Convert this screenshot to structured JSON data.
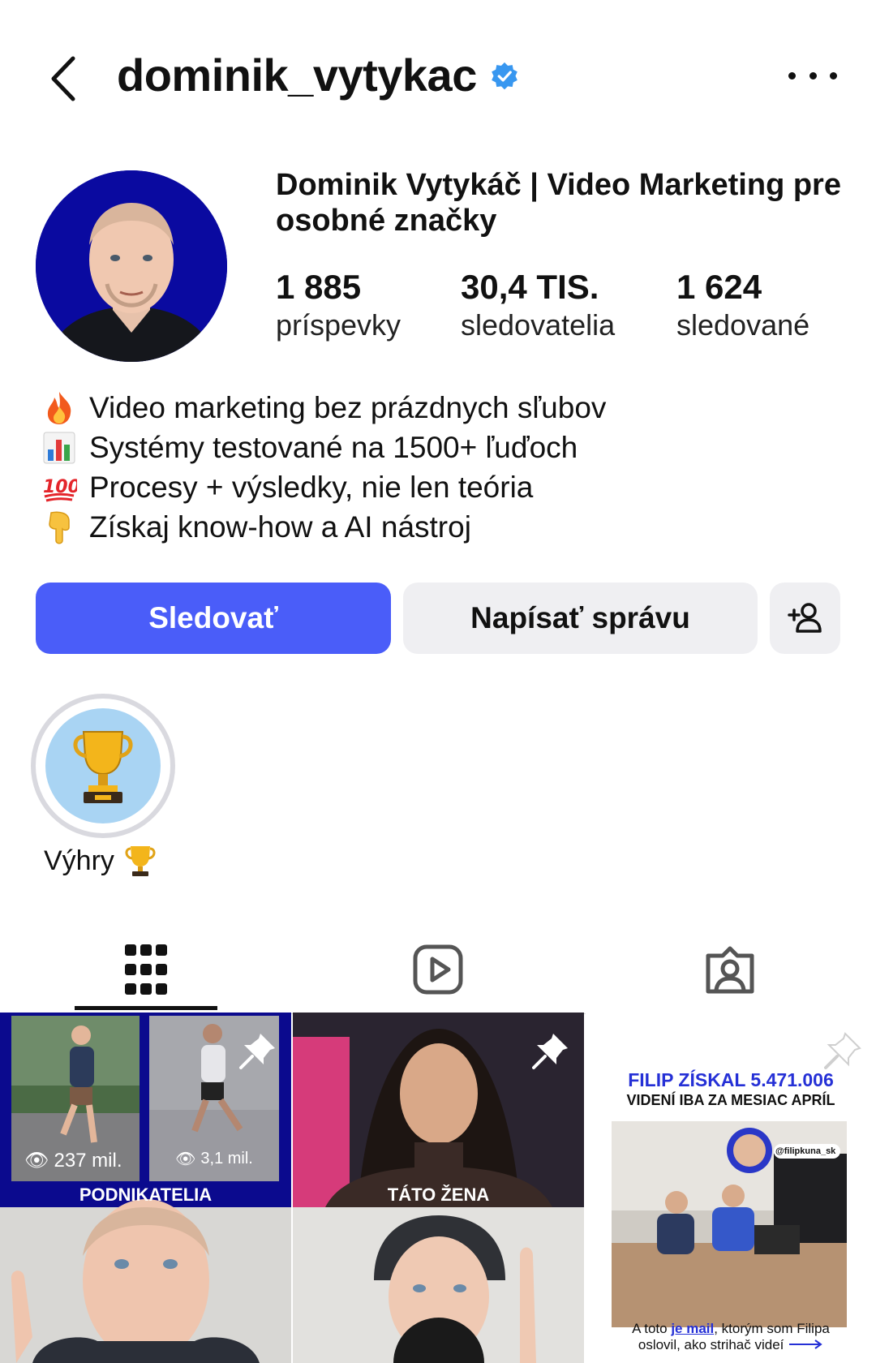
{
  "header": {
    "username": "dominik_vytykac",
    "verified": true,
    "icons": {
      "back": "chevron-left-icon",
      "more": "more-horizontal-icon",
      "verified": "verified-badge-icon"
    }
  },
  "profile": {
    "full_name": "Dominik Vytykáč | Video Marketing pre osobné značky",
    "stats": [
      {
        "value": "1 885",
        "label": "príspevky"
      },
      {
        "value": "30,4 TIS.",
        "label": "sledovatelia"
      },
      {
        "value": "1 624",
        "label": "sledované"
      }
    ],
    "bio": [
      {
        "emoji": "fire-icon",
        "text": "Video marketing bez prázdnych sľubov"
      },
      {
        "emoji": "bar-chart-icon",
        "text": "Systémy testované na 1500+ ľuďoch"
      },
      {
        "emoji": "hundred-points-icon",
        "text": "Procesy + výsledky, nie len teória"
      },
      {
        "emoji": "pointing-down-icon",
        "text": "Získaj know-how a AI nástroj"
      }
    ]
  },
  "actions": {
    "follow_label": "Sledovať",
    "message_label": "Napísať správu",
    "add_person_icon": "add-person-icon",
    "accent_color": "#4a5df9"
  },
  "highlights": [
    {
      "label": "Výhry",
      "icon": "trophy-icon"
    }
  ],
  "tabs": [
    {
      "name": "grid",
      "icon": "grid-icon",
      "active": true
    },
    {
      "name": "reels",
      "icon": "reels-icon",
      "active": false
    },
    {
      "name": "tagged",
      "icon": "tagged-icon",
      "active": false
    }
  ],
  "posts": [
    {
      "pinned": true,
      "views_left": "237 mil.",
      "views_right": "3,1 mil.",
      "caption": "PODNIKATELIA"
    },
    {
      "pinned": true,
      "caption": "TÁTO ŽENA"
    },
    {
      "pinned": true,
      "title_line1": "FILIP ZÍSKAL 5.471.006",
      "title_line2": "VIDENÍ IBA ZA MESIAC APRÍL",
      "handle": "@filipkuna_sk",
      "footer_line1_a": "A toto ",
      "footer_line1_b": "je mail",
      "footer_line1_c": ", ktorým som Filipa",
      "footer_line2": "oslovil, ako strihač videí"
    }
  ]
}
